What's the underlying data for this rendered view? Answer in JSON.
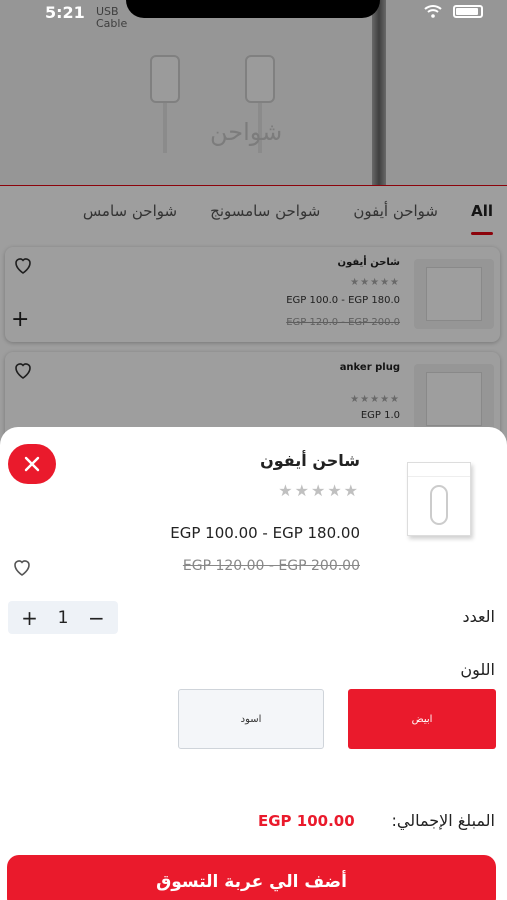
{
  "status_bar": {
    "time": "5:21"
  },
  "hero": {
    "caption_top": "USB",
    "caption_sub": "Cable",
    "watermark": "شواحن"
  },
  "tabs": [
    {
      "label": "All"
    },
    {
      "label": "شواحن أيفون"
    },
    {
      "label": "شواحن سامسونج"
    },
    {
      "label": "شواحن سامس"
    }
  ],
  "products": [
    {
      "title": "شاحن أيفون",
      "stars": "★★★★★",
      "price": "EGP 100.0 - EGP 180.0",
      "old_price": "EGP 120.0 - EGP 200.0"
    },
    {
      "title": "anker plug",
      "stars": "★★★★★",
      "price": "EGP 1.0",
      "old_price": ""
    }
  ],
  "sheet": {
    "title": "شاحن أيفون",
    "stars": "★★★★★",
    "price": "EGP 100.00 - EGP 180.00",
    "old_price": "EGP 120.00 - EGP 200.00",
    "quantity_label": "العدد",
    "quantity_value": "1",
    "plus_symbol": "+",
    "minus_symbol": "−",
    "color_label": "اللون",
    "colors": [
      {
        "label": "ابيض",
        "selected": true
      },
      {
        "label": "اسود",
        "selected": false
      }
    ],
    "total_label": "المبلغ الإجمالي:",
    "total_value": "EGP 100.00",
    "add_to_cart_label": "أضف الي عربة التسوق"
  },
  "theme": {
    "accent": "#ea1a2c",
    "muted_star": "#c0c0c0"
  },
  "icons": [
    "close-icon",
    "heart-icon",
    "plus-icon",
    "wifi-icon",
    "battery-icon"
  ]
}
